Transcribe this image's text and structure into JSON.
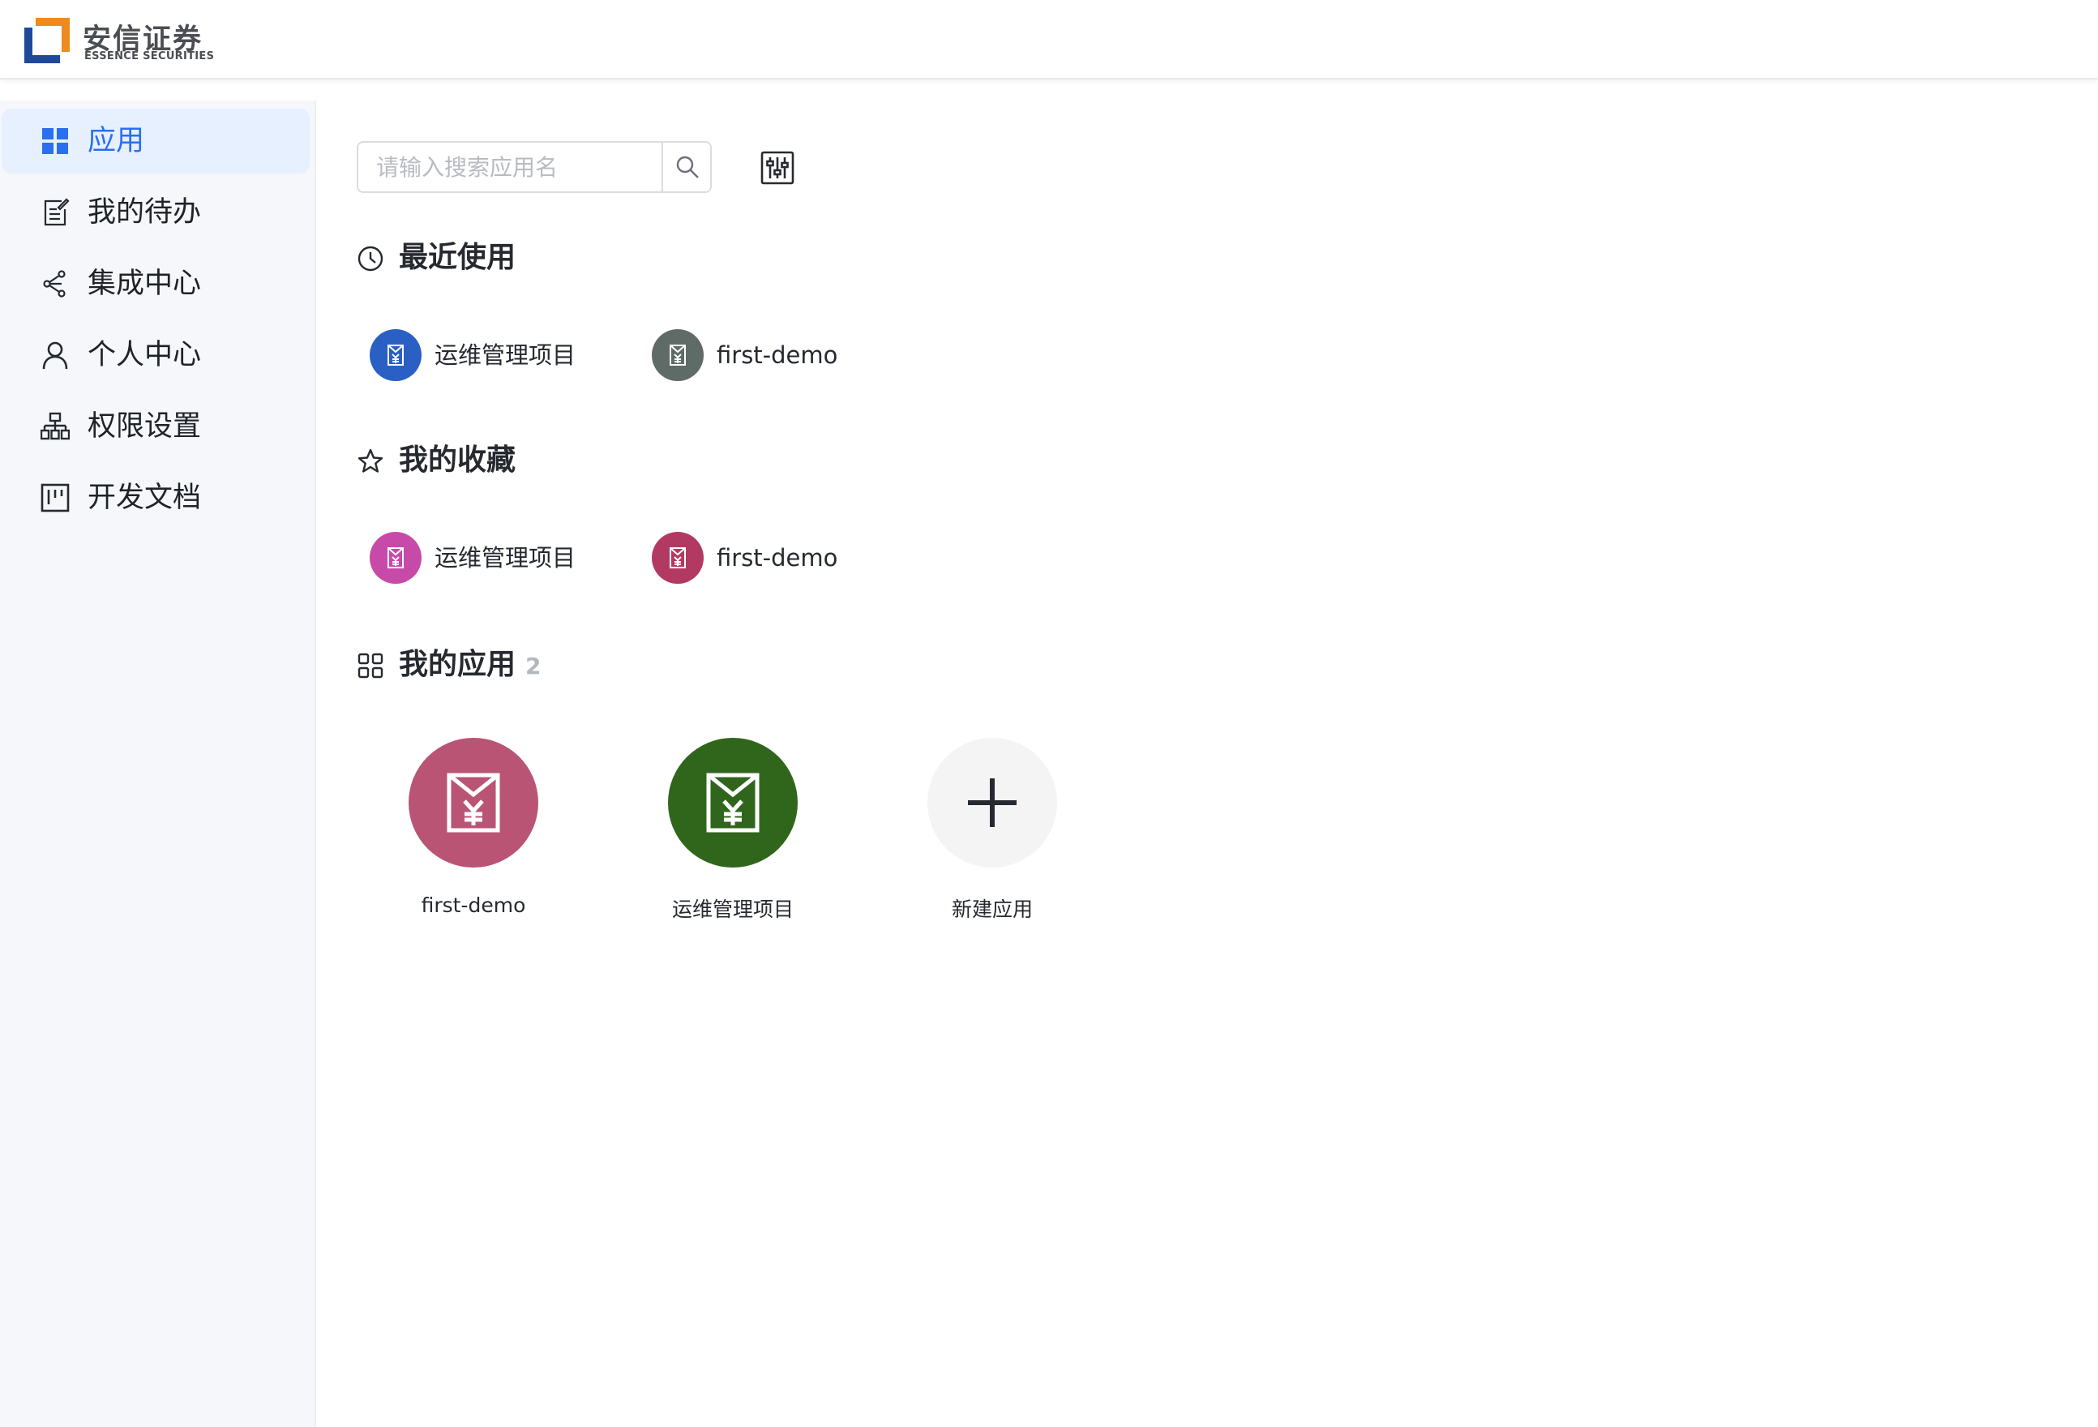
{
  "brand": {
    "name_cn": "安信证券",
    "name_en": "ESSENCE SECURITIES",
    "colors": {
      "orange": "#ef8a1f",
      "blue": "#1f4a9c"
    }
  },
  "sidebar": {
    "items": [
      {
        "label": "应用",
        "icon": "grid-icon",
        "active": true
      },
      {
        "label": "我的待办",
        "icon": "todo-edit-icon",
        "active": false
      },
      {
        "label": "集成中心",
        "icon": "integration-icon",
        "active": false
      },
      {
        "label": "个人中心",
        "icon": "user-icon",
        "active": false
      },
      {
        "label": "权限设置",
        "icon": "org-chart-icon",
        "active": false
      },
      {
        "label": "开发文档",
        "icon": "document-board-icon",
        "active": false
      }
    ],
    "active_color": "#2a6ff0"
  },
  "search": {
    "placeholder": "请输入搜索应用名",
    "value": ""
  },
  "recent": {
    "title": "最近使用",
    "items": [
      {
        "label": "运维管理项目",
        "color": "#2a5fc4"
      },
      {
        "label": "first-demo",
        "color": "#5f6b66"
      }
    ]
  },
  "favorites": {
    "title": "我的收藏",
    "items": [
      {
        "label": "运维管理项目",
        "color": "#c84aa8"
      },
      {
        "label": "first-demo",
        "color": "#b23a62"
      }
    ]
  },
  "my_apps": {
    "title": "我的应用",
    "count": "2",
    "items": [
      {
        "label": "first-demo",
        "color": "#b95474"
      },
      {
        "label": "运维管理项目",
        "color": "#30661c"
      }
    ],
    "new_app_label": "新建应用"
  }
}
